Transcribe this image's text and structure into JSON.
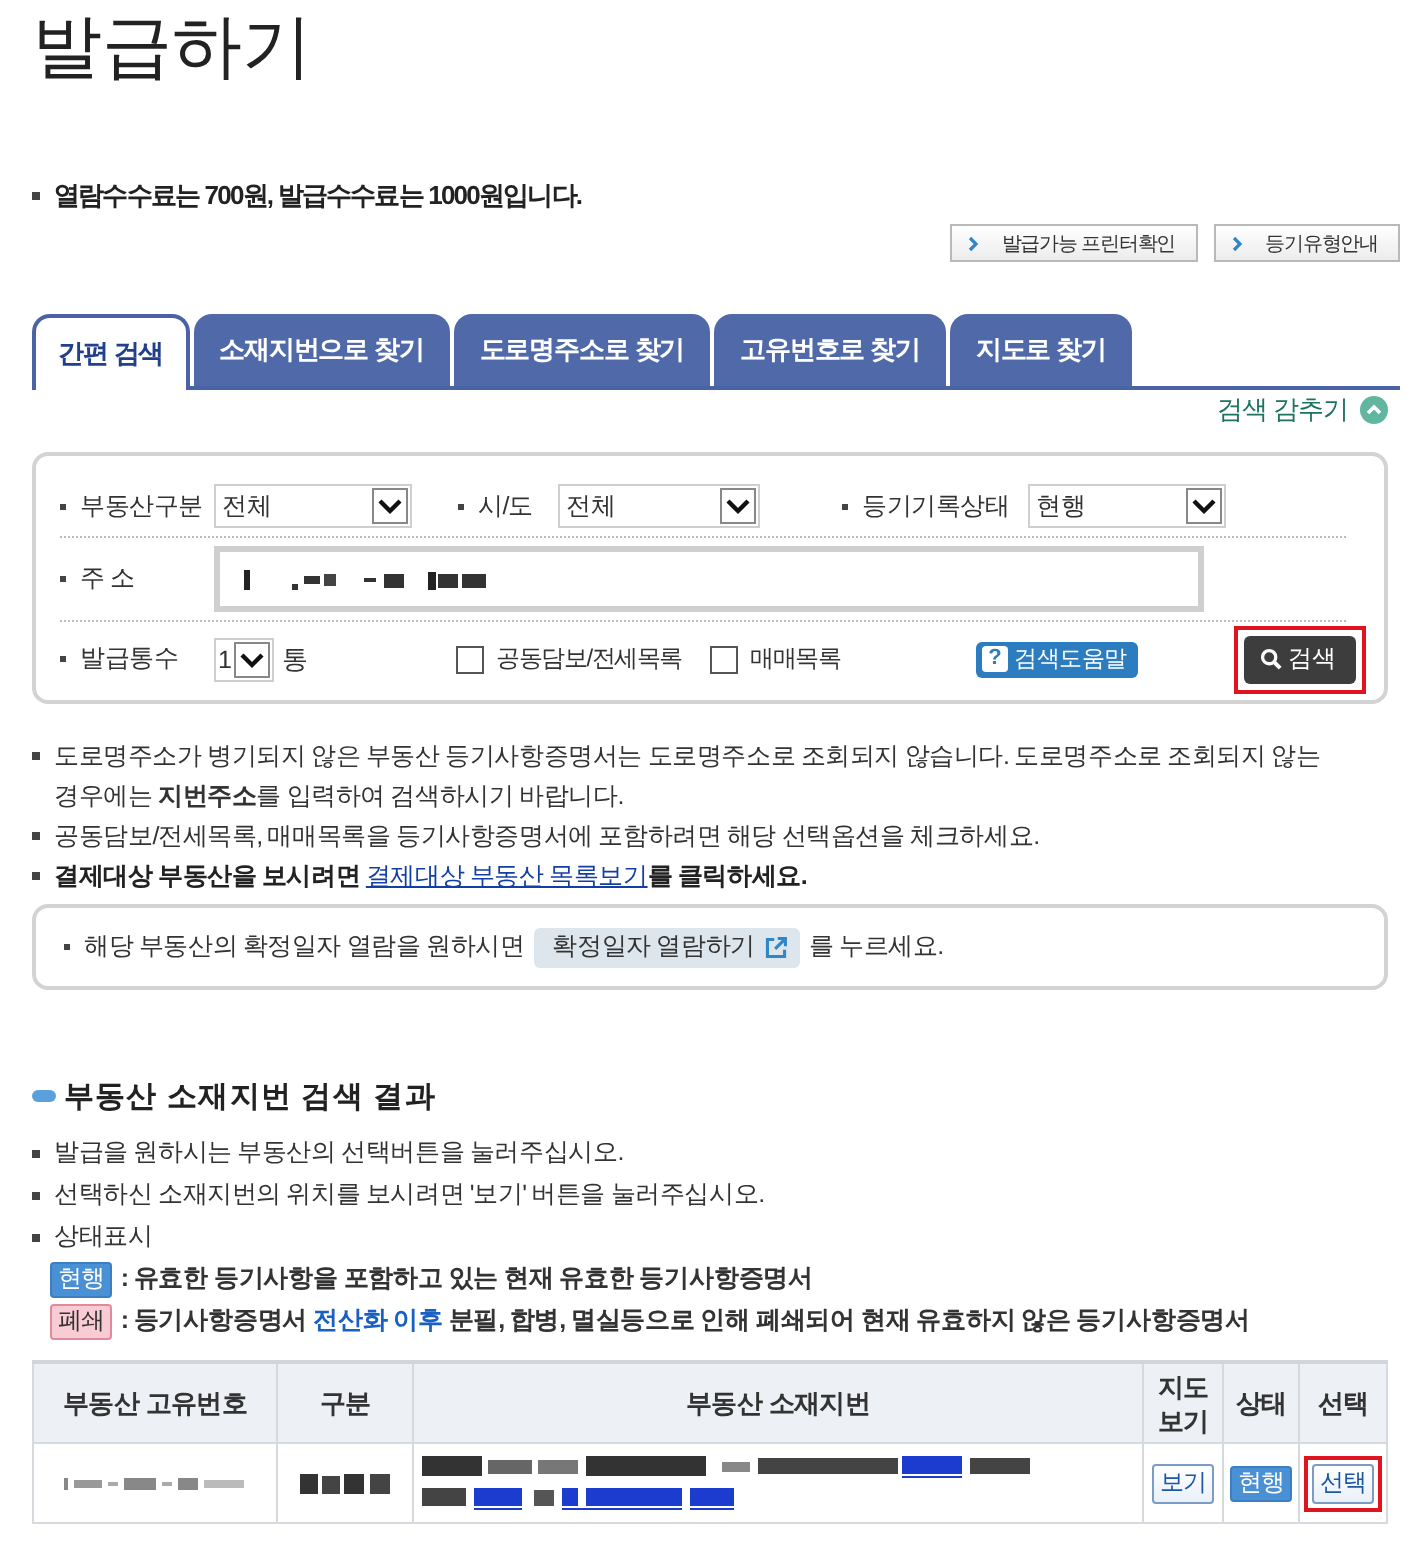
{
  "page": {
    "title": "발급하기"
  },
  "fee_notice": "열람수수료는 700원, 발급수수료는 1000원입니다.",
  "top_buttons": [
    {
      "label": "발급가능 프린터확인"
    },
    {
      "label": "등기유형안내"
    }
  ],
  "tabs": [
    {
      "label": "간편 검색",
      "selected": true
    },
    {
      "label": "소재지번으로 찾기",
      "selected": false
    },
    {
      "label": "도로명주소로 찾기",
      "selected": false
    },
    {
      "label": "고유번호로 찾기",
      "selected": false
    },
    {
      "label": "지도로 찾기",
      "selected": false
    }
  ],
  "search_toggle": {
    "label": "검색 감추기"
  },
  "search_form": {
    "selects": [
      {
        "label": "부동산구분",
        "value": "전체"
      },
      {
        "label": "시/도",
        "value": "전체"
      },
      {
        "label": "등기기록상태",
        "value": "현행"
      }
    ],
    "address": {
      "label": "주 소"
    },
    "copies": {
      "label": "발급통수",
      "value": "1",
      "unit": "통"
    },
    "options": [
      {
        "label": "공동담보/전세목록",
        "checked": false
      },
      {
        "label": "매매목록",
        "checked": false
      }
    ],
    "help_button": {
      "icon": "?",
      "label": "검색도움말"
    },
    "search_button": {
      "label": "검색",
      "highlighted": true
    }
  },
  "notes": [
    {
      "kind": "text",
      "text": "도로명주소가 병기되지 않은 부동산 등기사항증명서는 도로명주소로 조회되지 않습니다. 도로명주소로 조회되지 않는 경우에는 **지번주소**를 입력하여 검색하시기 바랍니다."
    },
    {
      "kind": "text",
      "text": "공동담보/전세목록, 매매목록을 등기사항증명서에 포함하려면 해당 선택옵션을 체크하세요."
    },
    {
      "kind": "link",
      "before": "결제대상 부동산을 보시려면",
      "link": "결제대상 부동산 목록보기",
      "after": "를 클릭하세요."
    }
  ],
  "date_notice": {
    "before": "해당 부동산의 확정일자 열람을 원하시면",
    "button": "확정일자 열람하기",
    "after": "를 누르세요."
  },
  "results": {
    "heading": "부동산 소재지번 검색 결과",
    "instructions": [
      "발급을 원하시는 부동산의 선택버튼을 눌러주십시오.",
      "선택하신 소재지번의 위치를 보시려면 '보기' 버튼을 눌러주십시오.",
      "상태표시"
    ],
    "legend": [
      {
        "badge": "현행",
        "kind": "current",
        "text": ": 유효한 등기사항을 포함하고 있는 현재 유효한 등기사항증명서"
      },
      {
        "badge": "폐쇄",
        "kind": "closed",
        "text": ": 등기사항증명서",
        "highlight": "전산화 이후",
        "text_after": "분필, 합병, 멸실등으로 인해 폐쇄되어 현재 유효하지 않은 등기사항증명서"
      }
    ]
  },
  "table": {
    "columns": [
      "부동산 고유번호",
      "구분",
      "부동산 소재지번",
      "지도 보기",
      "상태",
      "선택"
    ],
    "rows": [
      {
        "map_button": "보기",
        "status": {
          "label": "현행",
          "kind": "current"
        },
        "select_button": {
          "label": "선택",
          "highlighted": true
        }
      }
    ]
  }
}
